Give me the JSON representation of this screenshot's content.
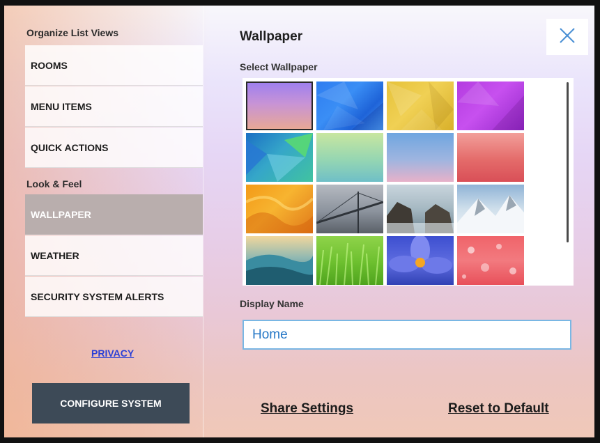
{
  "sidebar": {
    "organize_header": "Organize List Views",
    "organize_items": [
      {
        "label": "ROOMS"
      },
      {
        "label": "MENU ITEMS"
      },
      {
        "label": "QUICK ACTIONS"
      }
    ],
    "look_header": "Look & Feel",
    "look_items": [
      {
        "label": "WALLPAPER",
        "selected": true
      },
      {
        "label": "WEATHER"
      },
      {
        "label": "SECURITY SYSTEM ALERTS"
      }
    ],
    "privacy_label": "PRIVACY",
    "configure_label": "CONFIGURE SYSTEM"
  },
  "main": {
    "title": "Wallpaper",
    "close_icon": "close-icon",
    "select_label": "Select Wallpaper",
    "wallpapers": [
      {
        "name": "purple-orange-gradient",
        "selected": true
      },
      {
        "name": "blue-low-poly"
      },
      {
        "name": "yellow-low-poly"
      },
      {
        "name": "purple-low-poly"
      },
      {
        "name": "green-blue-abstract"
      },
      {
        "name": "green-teal-blur"
      },
      {
        "name": "blue-pink-blur"
      },
      {
        "name": "red-blur"
      },
      {
        "name": "orange-waves"
      },
      {
        "name": "foggy-bridge"
      },
      {
        "name": "rocky-beach"
      },
      {
        "name": "snowy-mountains"
      },
      {
        "name": "teal-hills"
      },
      {
        "name": "green-grass"
      },
      {
        "name": "blue-flower"
      },
      {
        "name": "red-bokeh"
      }
    ],
    "display_name_label": "Display Name",
    "display_name_value": "Home",
    "share_label": "Share Settings",
    "reset_label": "Reset to Default"
  },
  "colors": {
    "selected_item": "#b9aead",
    "configure_button": "#3d4a57",
    "input_border": "#79b7e4",
    "input_text": "#2577c6",
    "privacy_link": "#2a3fd6"
  }
}
